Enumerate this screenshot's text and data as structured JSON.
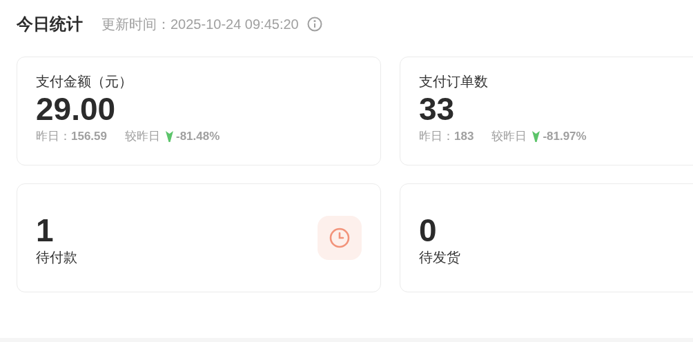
{
  "header": {
    "title": "今日统计",
    "updated_label": "更新时间：",
    "updated_time": "2025-10-24 09:45:20"
  },
  "cards": [
    {
      "kind": "metric",
      "label": "支付金额（元）",
      "value": "29.00",
      "yesterday_label": "昨日：",
      "yesterday_value": "156.59",
      "compare_label": "较昨日",
      "decreased": true,
      "change": "-81.48%"
    },
    {
      "kind": "metric",
      "label": "支付订单数",
      "value": "33",
      "yesterday_label": "昨日：",
      "yesterday_value": "183",
      "compare_label": "较昨日",
      "decreased": true,
      "change": "-81.97%"
    },
    {
      "kind": "timer",
      "value": "1",
      "label": "待付款"
    },
    {
      "kind": "pending",
      "value": "0",
      "label": "待发货"
    }
  ]
}
